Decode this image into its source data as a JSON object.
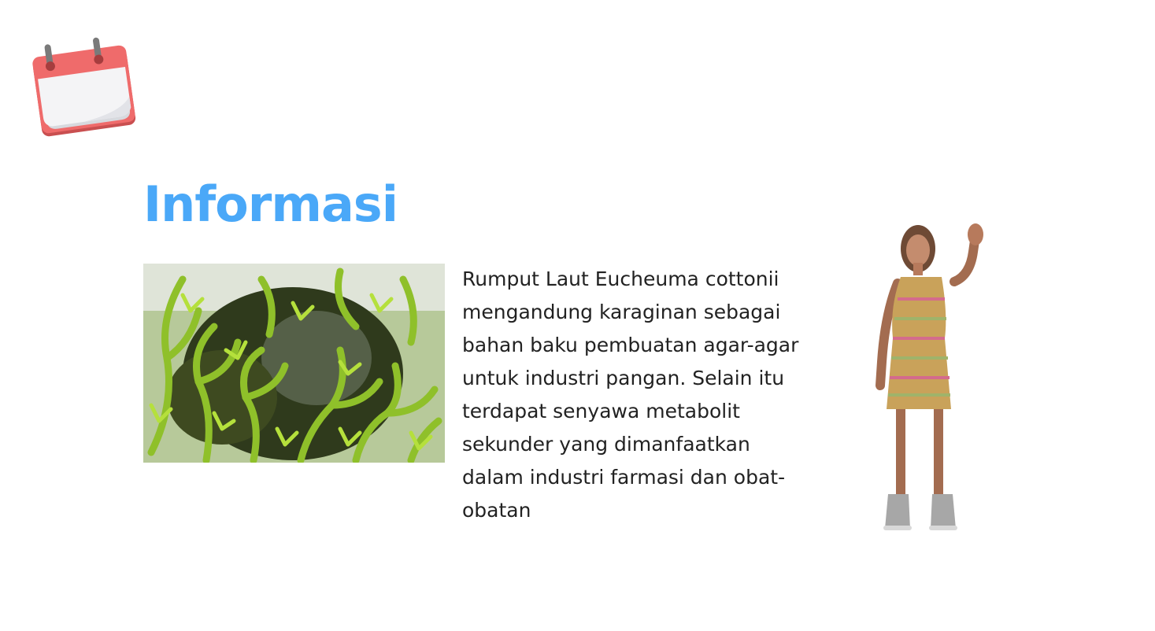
{
  "title": "Informasi",
  "body_text": "Rumput Laut Eucheuma cottonii mengandung karaginan sebagai bahan baku pembuatan agar-agar untuk industri pangan. Selain itu terdapat senyawa metabolit sekunder yang dimanfaatkan dalam industri farmasi dan obat-obatan",
  "icons": {
    "calendar": "calendar-icon"
  },
  "colors": {
    "title": "#4aa8f8",
    "body_text": "#222222",
    "calendar_red": "#ef6b6b",
    "seaweed_green": "#7fb51e"
  }
}
